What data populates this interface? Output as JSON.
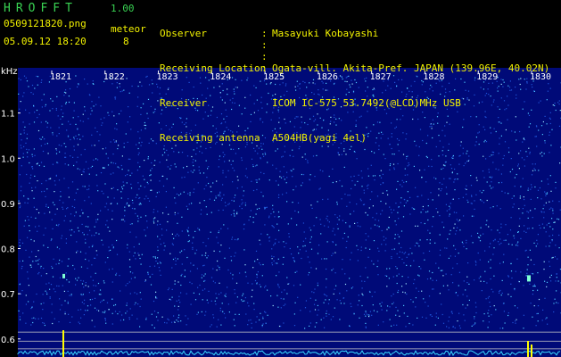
{
  "header": {
    "app_title": "HROFFT",
    "app_version": "1.00",
    "filename": "0509121820.png",
    "datetime": "05.09.12 18:20",
    "meteor_label": "meteor",
    "meteor_count": "8",
    "info": [
      {
        "key": "Observer",
        "value": "Masayuki Kobayashi"
      },
      {
        "key": "Receiving Location",
        "value": "Ogata-vill. Akita-Pref. JAPAN (139.96E, 40.02N)"
      },
      {
        "key": "Receiver",
        "value": "ICOM IC-575 53.7492(@LCD)MHz USB"
      },
      {
        "key": "Receiving antenna",
        "value": "A504HB(yagi 4el)"
      }
    ]
  },
  "chart_data": {
    "type": "heatmap",
    "ylabel": "kHz",
    "yticks": [
      "1.1",
      "1.0",
      "0.9",
      "0.8",
      "0.7",
      "0.6"
    ],
    "ytick_values": [
      1.1,
      1.0,
      0.9,
      0.8,
      0.7,
      0.6
    ],
    "ylim": [
      0.56,
      1.2
    ],
    "x_minutes": [
      "1821",
      "1822",
      "1823",
      "1824",
      "1825",
      "1826",
      "1827",
      "1828",
      "1829",
      "1830"
    ],
    "meteor_echoes_khz": [
      0.74,
      0.735
    ]
  },
  "colors": {
    "header_green": "#39d353",
    "header_yellow": "#f2f200",
    "spectrogram_base": "#000a78",
    "speck": "#4cc6ff",
    "level_trace": "#38d8ff",
    "spike": "#ffff00"
  }
}
